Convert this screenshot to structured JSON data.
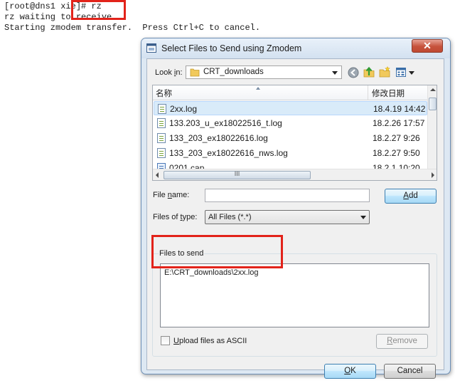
{
  "terminal": {
    "lines": [
      "[root@dns1 xie]# rz",
      "rz waiting to receive.",
      "Starting zmodem transfer.  Press Ctrl+C to cancel."
    ]
  },
  "dialog": {
    "title": "Select Files to Send using Zmodem",
    "close_label": "✕",
    "look_in_label_pre": "Look ",
    "look_in_label_key": "i",
    "look_in_label_post": "n:",
    "look_in_value": "CRT_downloads",
    "toolbar_icons": [
      "back-icon",
      "up-folder-icon",
      "new-folder-icon",
      "view-menu-icon"
    ],
    "columns": {
      "name": "名称",
      "modified": "修改日期"
    },
    "files": [
      {
        "name": "2xx.log",
        "date": "18.4.19 14:42",
        "icon": "log-file-icon",
        "selected": true
      },
      {
        "name": "133.203_u_ex18022516_t.log",
        "date": "18.2.26 17:57",
        "icon": "log-file-icon",
        "selected": false
      },
      {
        "name": "133_203_ex18022616.log",
        "date": "18.2.27 9:26",
        "icon": "log-file-icon",
        "selected": false
      },
      {
        "name": "133_203_ex18022616_nws.log",
        "date": "18.2.27 9:50",
        "icon": "log-file-icon",
        "selected": false
      },
      {
        "name": "0201.cap",
        "date": "18.2.1 10:20",
        "icon": "cap-file-icon",
        "selected": false
      }
    ],
    "scroll_grip": "III",
    "file_name_label_pre": "File ",
    "file_name_label_key": "n",
    "file_name_label_post": "ame:",
    "file_name_value": "",
    "file_type_label_pre": "Files of ",
    "file_type_label_key": "t",
    "file_type_label_post": "ype:",
    "file_type_value": "All Files (*.*)",
    "add_label_key": "A",
    "add_label_post": "dd",
    "files_to_send_label": "Files to send",
    "files_to_send": [
      "E:\\CRT_downloads\\2xx.log"
    ],
    "ascii_label_key": "U",
    "ascii_label_post": "pload files as ASCII",
    "ascii_checked": false,
    "remove_label_key": "R",
    "remove_label_post": "emove",
    "ok_label_key": "O",
    "ok_label_post": "K",
    "cancel_label": "Cancel"
  },
  "colors": {
    "highlight_box": "#e2231a",
    "selection": "#d9ebf9"
  }
}
